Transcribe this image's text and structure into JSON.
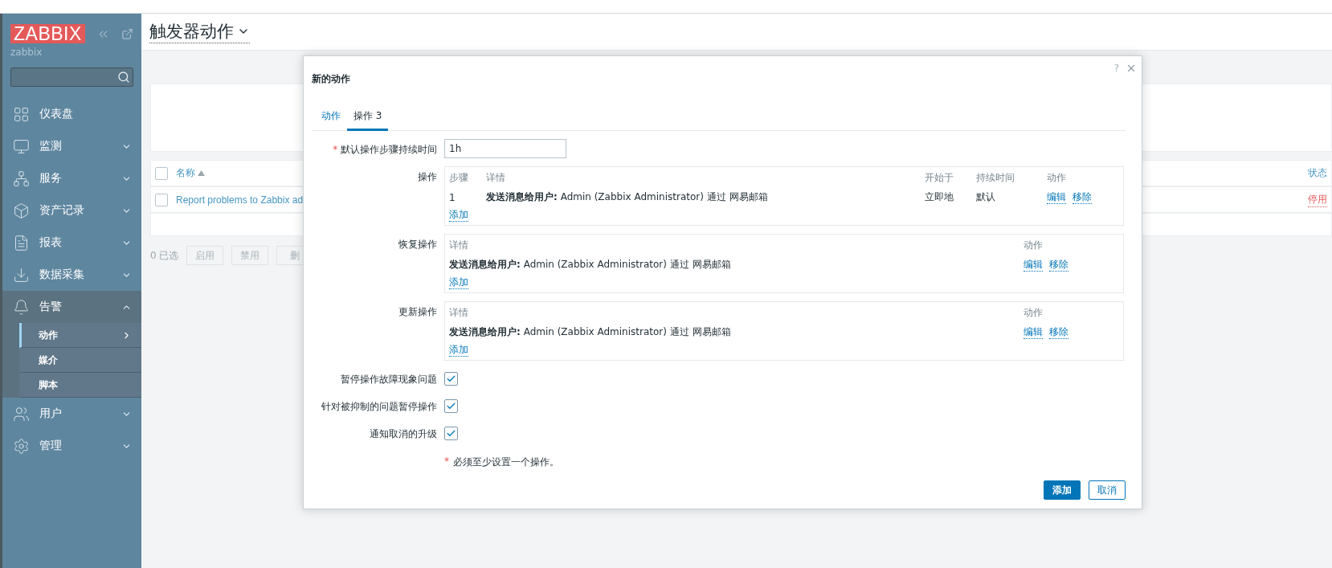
{
  "sidebar": {
    "logo": "ZABBIX",
    "server_name": "zabbix",
    "items": [
      {
        "label": "仪表盘",
        "kind": "link",
        "expanded": false
      },
      {
        "label": "监测",
        "kind": "menu",
        "expanded": false
      },
      {
        "label": "服务",
        "kind": "menu",
        "expanded": false
      },
      {
        "label": "资产记录",
        "kind": "menu",
        "expanded": false
      },
      {
        "label": "报表",
        "kind": "menu",
        "expanded": false
      },
      {
        "label": "数据采集",
        "kind": "menu",
        "expanded": false
      },
      {
        "label": "告警",
        "kind": "menu",
        "expanded": true,
        "children": [
          {
            "label": "动作",
            "selected": true
          },
          {
            "label": "媒介",
            "selected": false
          },
          {
            "label": "脚本",
            "selected": false
          }
        ]
      },
      {
        "label": "用户",
        "kind": "menu",
        "expanded": false
      },
      {
        "label": "管理",
        "kind": "menu",
        "expanded": false
      }
    ]
  },
  "page": {
    "title": "触发器动作",
    "table": {
      "header_checked": false,
      "columns": [
        {
          "label": "名称",
          "sorted": true
        },
        {
          "label": "状态",
          "sorted": false
        }
      ],
      "rows": [
        {
          "checked": false,
          "name": "Report problems to Zabbix ad",
          "status": "停用"
        }
      ]
    },
    "selection_count": "0 已选",
    "actions": [
      "启用",
      "禁用",
      "删"
    ]
  },
  "dialog": {
    "title": "新的动作",
    "help": "?",
    "tabs": [
      {
        "label": "动作",
        "selected": false
      },
      {
        "label": "操作",
        "count": "3",
        "selected": true
      }
    ],
    "duration": {
      "label": "默认操作步骤持续时间",
      "marker": "*",
      "value": "1h"
    },
    "operations": {
      "label": "操作",
      "columns": [
        "步骤",
        "详情",
        "开始于",
        "持续时间",
        "动作"
      ],
      "rows": [
        {
          "step": "1",
          "details": "**发送消息给用户:** Admin (Zabbix Administrator) 通过 网易邮箱",
          "start": "立即地",
          "duration": "默认",
          "links": [
            "编辑",
            "移除"
          ]
        }
      ],
      "add": "添加"
    },
    "sections": [
      {
        "label": "恢复操作",
        "columns": [
          "详情",
          "动作"
        ],
        "rows": [
          {
            "details": "**发送消息给用户:** Admin (Zabbix Administrator) 通过 网易邮箱",
            "links": [
              "编辑",
              "移除"
            ]
          }
        ],
        "add": "添加"
      },
      {
        "label": "更新操作",
        "columns": [
          "详情",
          "动作"
        ],
        "rows": [
          {
            "details": "**发送消息给用户:** Admin (Zabbix Administrator) 通过 网易邮箱",
            "links": [
              "编辑",
              "移除"
            ]
          }
        ],
        "add": "添加"
      }
    ],
    "options": [
      {
        "label": "暂停操作故障现象问题",
        "checked": true
      },
      {
        "label": "针对被抑制的问题暂停操作",
        "checked": true
      },
      {
        "label": "通知取消的升级",
        "checked": true
      }
    ],
    "note": {
      "marker": "*",
      "text": "必须至少设置一个操作。"
    },
    "buttons": [
      {
        "label": "添加",
        "kind": "primary"
      },
      {
        "label": "取消",
        "kind": "secondary"
      }
    ]
  }
}
